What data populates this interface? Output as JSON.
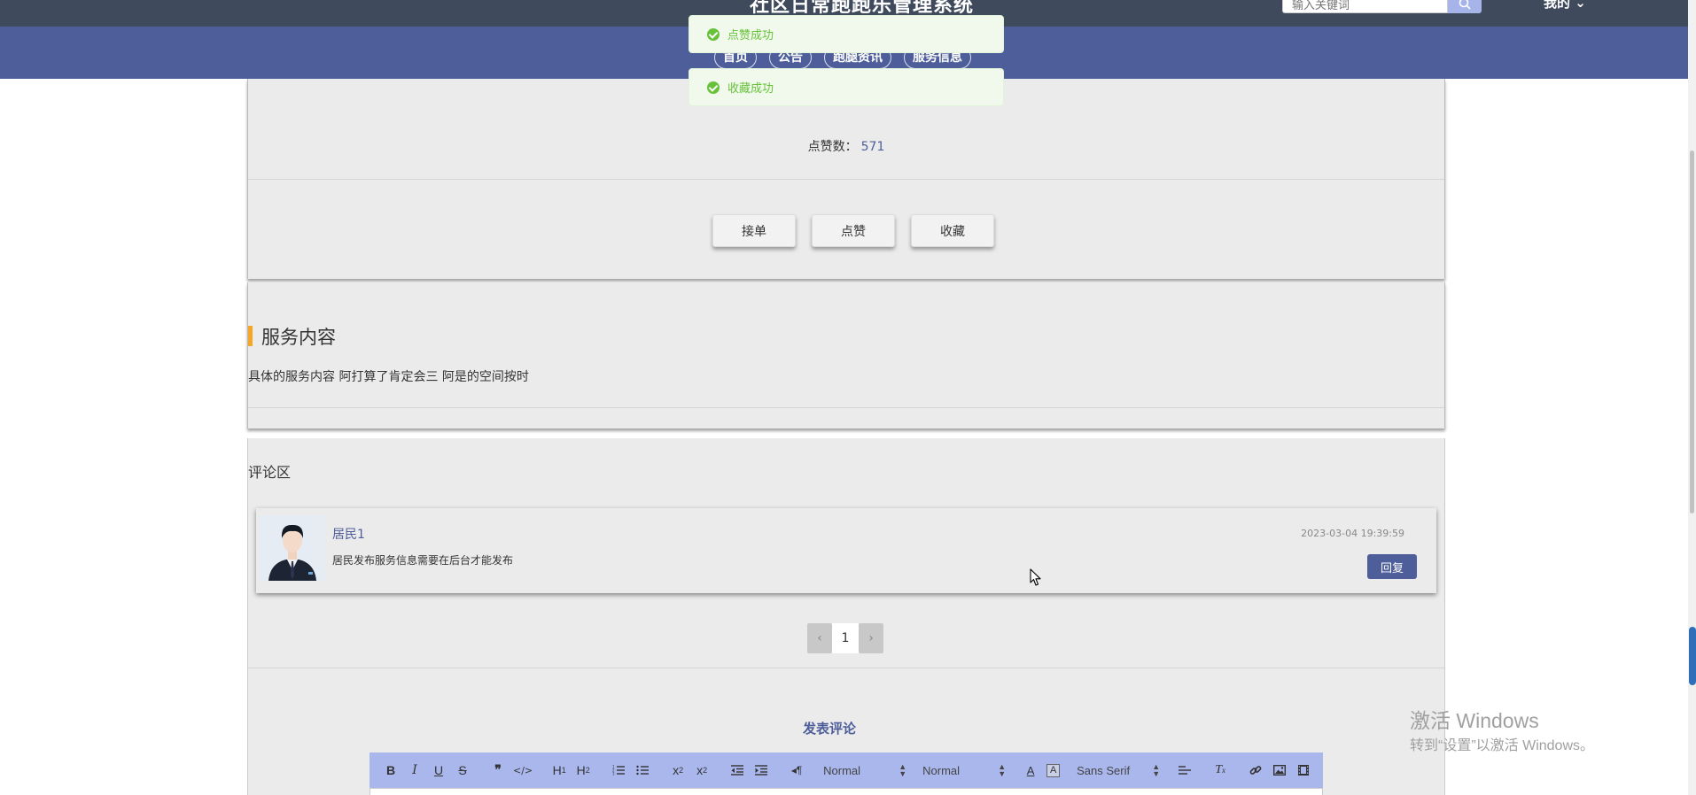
{
  "header": {
    "site_title": "社区日常跑跑乐管理系统",
    "search_placeholder": "输入关键词",
    "user_label": "我的 ⌄"
  },
  "nav": {
    "items": [
      "首页",
      "公告",
      "跑腿资讯",
      "服务信息"
    ]
  },
  "toasts": [
    {
      "text": "点赞成功",
      "type": "success"
    },
    {
      "text": "收藏成功",
      "type": "success"
    }
  ],
  "detail": {
    "likes_label": "点赞数：",
    "likes_value": "571",
    "buttons": {
      "accept": "接单",
      "like": "点赞",
      "favorite": "收藏"
    }
  },
  "service": {
    "title": "服务内容",
    "content": "具体的服务内容 阿打算了肯定会三 阿是的空间按时"
  },
  "comments": {
    "heading": "评论区",
    "items": [
      {
        "user": "居民1",
        "text": "居民发布服务信息需要在后台才能发布",
        "time": "2023-03-04 19:39:59",
        "reply_label": "回复"
      }
    ],
    "pager": {
      "prev": "‹",
      "page": "1",
      "next": "›"
    },
    "post_title": "发表评论"
  },
  "editor": {
    "buttons": [
      "B",
      "I",
      "U",
      "S",
      "❞",
      "</>",
      "H1",
      "H2",
      "ol",
      "ul",
      "x₂",
      "x²",
      "outdent",
      "indent",
      "rtl",
      "color",
      "background",
      "align",
      "clean",
      "link",
      "image",
      "video"
    ],
    "size_select": "Normal",
    "header_select": "Normal",
    "font_select": "Sans Serif"
  },
  "watermark": {
    "line1": "激活 Windows",
    "line2": "转到“设置”以激活 Windows。"
  },
  "colors": {
    "primary": "#4d5e9a",
    "accent": "#f5a623",
    "success": "#67c23a",
    "panel_bg": "#ebebeb"
  }
}
